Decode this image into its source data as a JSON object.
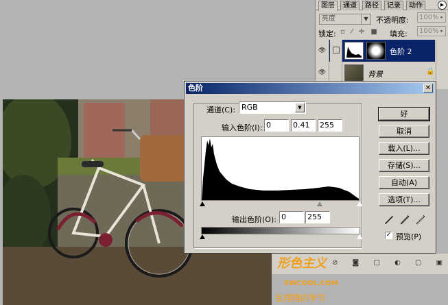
{
  "layers_panel": {
    "tabs": [
      "图层",
      "通道",
      "路径",
      "记录",
      "动作"
    ],
    "blend_mode": "亮度",
    "opacity_label": "不透明度:",
    "opacity_value": "100%",
    "lock_label": "锁定:",
    "fill_label": "填充:",
    "fill_value": "100%",
    "layers": [
      {
        "name": "色阶 2",
        "selected": true
      },
      {
        "name": "背景",
        "selected": false
      }
    ]
  },
  "levels_dialog": {
    "title": "色阶",
    "channel_label": "通道(C):",
    "channel_value": "RGB",
    "input_label": "输入色阶(I):",
    "input_black": "0",
    "input_gamma": "0.41",
    "input_white": "255",
    "output_label": "输出色阶(O):",
    "output_black": "0",
    "output_white": "255",
    "buttons": {
      "ok": "好",
      "cancel": "取消",
      "load": "载入(L)...",
      "save": "存储(S)...",
      "auto": "自动(A)",
      "options": "选项(T)..."
    },
    "preview_label": "预览(P)",
    "preview_checked": true
  },
  "watermark": {
    "logo": "形色主义",
    "site": "SWCOOL.COM",
    "slogan": "乱糟糟的季节"
  },
  "colors": {
    "title_bar": "#0a246a",
    "selection": "#0a246a",
    "dialog_bg": "#d4d0c8",
    "watermark": "#f0a020"
  }
}
